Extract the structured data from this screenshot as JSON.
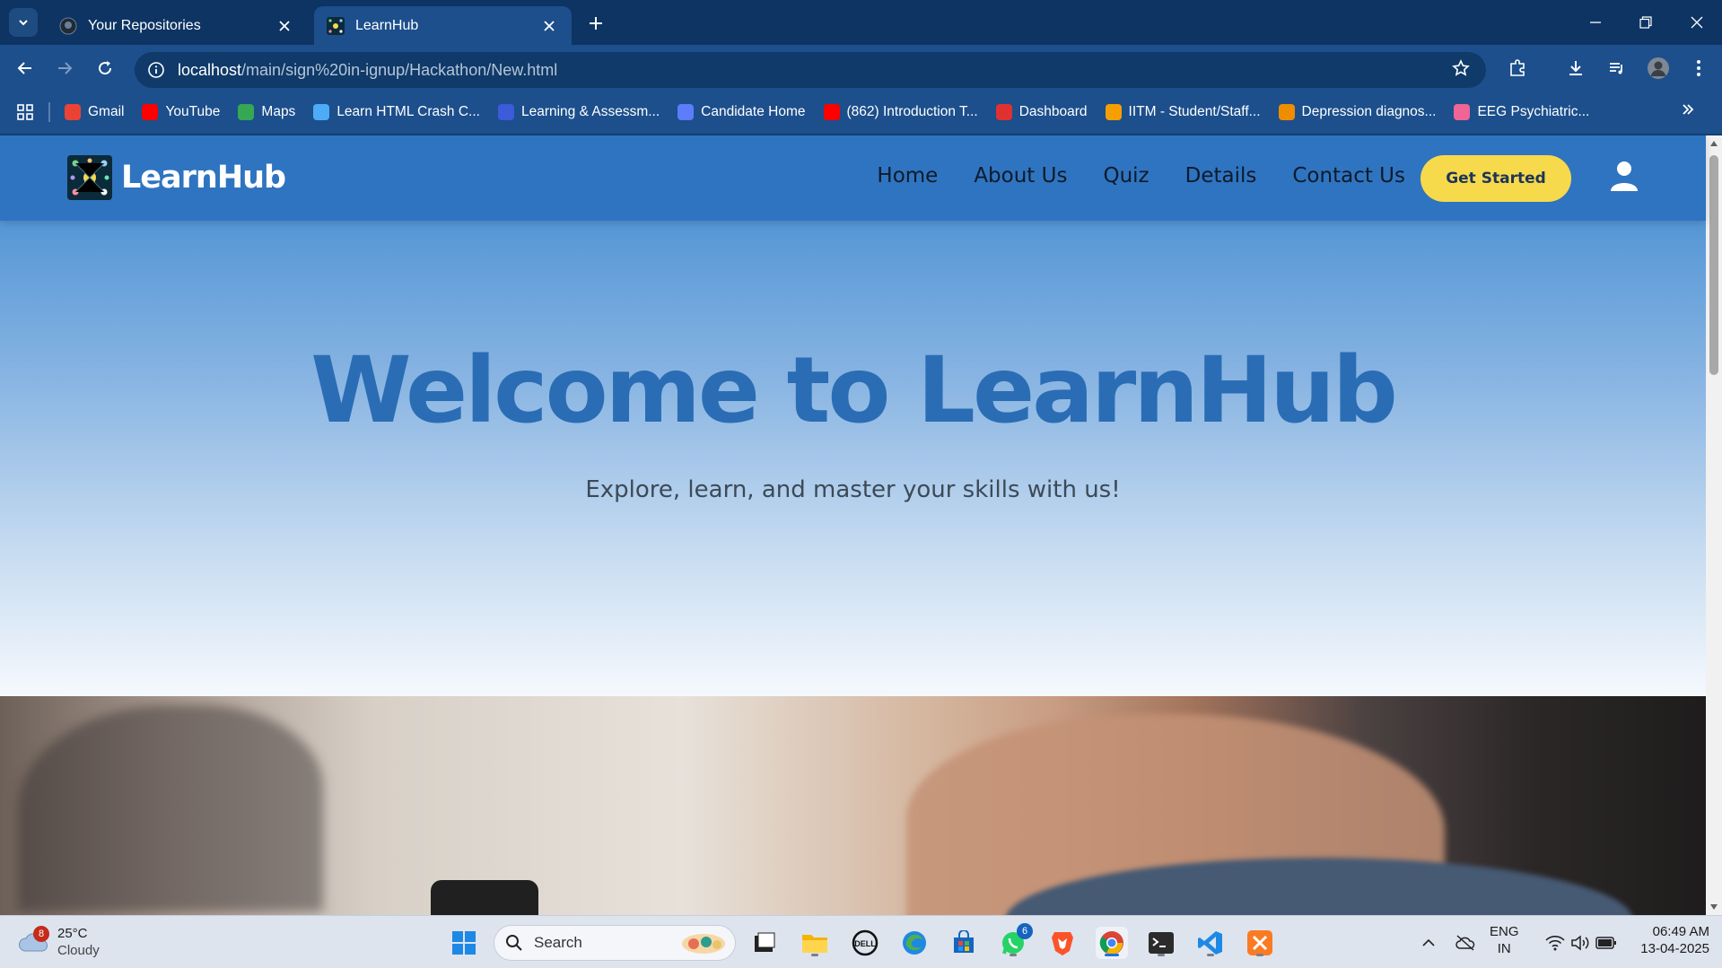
{
  "browser": {
    "tabs": [
      {
        "title": "Your Repositories",
        "active": false
      },
      {
        "title": "LearnHub",
        "active": true
      }
    ],
    "url": {
      "host": "localhost",
      "path": "/main/sign%20in-ignup/Hackathon/New.html"
    },
    "bookmarks": [
      {
        "label": "Gmail",
        "icon": "gmail-icon",
        "color": "#ea4335"
      },
      {
        "label": "YouTube",
        "icon": "youtube-icon",
        "color": "#ff0000"
      },
      {
        "label": "Maps",
        "icon": "maps-icon",
        "color": "#34a853"
      },
      {
        "label": "Learn HTML Crash C...",
        "icon": "m-icon",
        "color": "#4dabf7"
      },
      {
        "label": "Learning & Assessm...",
        "icon": "learning-icon",
        "color": "#3b5bdb"
      },
      {
        "label": "Candidate Home",
        "icon": "candidate-icon",
        "color": "#5c7cfa"
      },
      {
        "label": "(862) Introduction T...",
        "icon": "youtube-icon",
        "color": "#ff0000"
      },
      {
        "label": "Dashboard",
        "icon": "dashboard-icon",
        "color": "#e03131"
      },
      {
        "label": "IITM - Student/Staff...",
        "icon": "iitm-icon",
        "color": "#f59f00"
      },
      {
        "label": "Depression diagnos...",
        "icon": "e-icon",
        "color": "#f08c00"
      },
      {
        "label": "EEG Psychiatric...",
        "icon": "brain-icon",
        "color": "#f06595"
      }
    ]
  },
  "site": {
    "brand": "LearnHub",
    "nav": [
      "Home",
      "About Us",
      "Quiz",
      "Details",
      "Contact Us"
    ],
    "cta": "Get Started",
    "hero_title": "Welcome to LearnHub",
    "hero_subtitle": "Explore, learn, and master your skills with us!"
  },
  "taskbar": {
    "weather_badge": "8",
    "temperature": "25°C",
    "condition": "Cloudy",
    "search_placeholder": "Search",
    "whatsapp_badge": "6",
    "lang_top": "ENG",
    "lang_bottom": "IN",
    "time": "06:49 AM",
    "date": "13-04-2025"
  },
  "colors": {
    "chrome_dark": "#0d3463",
    "chrome": "#1c4f8c",
    "site_nav": "#2f74c0",
    "hero_title": "#2a6db5",
    "cta": "#f7d94c"
  }
}
